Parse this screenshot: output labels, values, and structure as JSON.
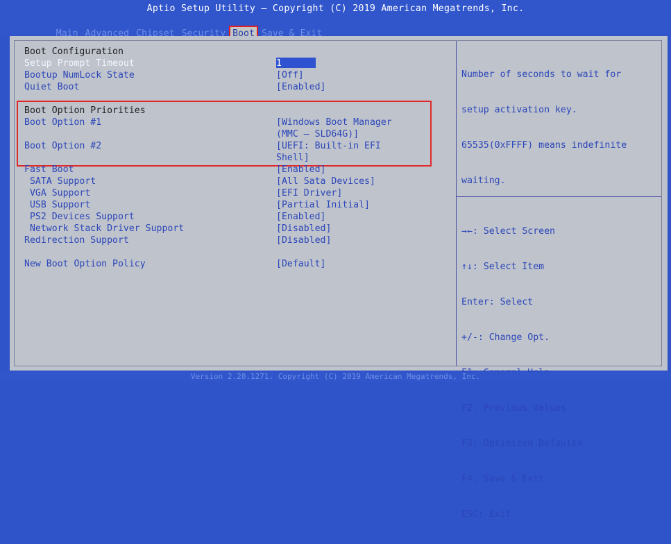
{
  "title": "Aptio Setup Utility – Copyright (C) 2019 American Megatrends, Inc.",
  "menu": [
    "Main",
    "Advanced",
    "Chipset",
    "Security",
    "Boot",
    "Save & Exit"
  ],
  "footer": "Version 2.20.1271. Copyright (C) 2019 American Megatrends, Inc.",
  "settings": {
    "boot_configuration": "Boot Configuration",
    "setup_prompt_timeout": {
      "label": "Setup Prompt Timeout",
      "value": "1"
    },
    "numlock": {
      "label": "Bootup NumLock State",
      "value": "[Off]"
    },
    "quiet_boot": {
      "label": "Quiet Boot",
      "value": "[Enabled]"
    },
    "boot_option_priorities": "Boot Option Priorities",
    "boot_option_1": {
      "label": "Boot Option #1",
      "value_line1": "[Windows Boot Manager",
      "value_line2": "(MMC – SLD64G)]"
    },
    "boot_option_2": {
      "label": "Boot Option #2",
      "value_line1": "[UEFI: Built-in EFI",
      "value_line2": "Shell]"
    },
    "fast_boot": {
      "label": "Fast Boot",
      "value": "[Enabled]"
    },
    "sata_support": {
      "label": " SATA Support",
      "value": "[All Sata Devices]"
    },
    "vga_support": {
      "label": " VGA Support",
      "value": "[EFI Driver]"
    },
    "usb_support": {
      "label": " USB Support",
      "value": "[Partial Initial]"
    },
    "ps2_support": {
      "label": " PS2 Devices Support",
      "value": "[Enabled]"
    },
    "network_stack": {
      "label": " Network Stack Driver Support",
      "value": "[Disabled]"
    },
    "redirection": {
      "label": "Redirection Support",
      "value": "[Disabled]"
    },
    "new_boot_policy": {
      "label": "New Boot Option Policy",
      "value": "[Default]"
    }
  },
  "help": {
    "description": [
      "Number of seconds to wait for",
      "setup activation key.",
      "65535(0xFFFF) means indefinite",
      "waiting."
    ],
    "keys": [
      "→←: Select Screen",
      "↑↓: Select Item",
      "Enter: Select",
      "+/-: Change Opt.",
      "F1: General Help",
      "F2: Previous Values",
      "F3: Optimized Defaults",
      "F4: Save & Exit",
      "ESC: Exit"
    ]
  },
  "colors": {
    "background": "#2f53c9",
    "panel": "#bfc3cc",
    "highlight_red": "#e02a2a"
  }
}
